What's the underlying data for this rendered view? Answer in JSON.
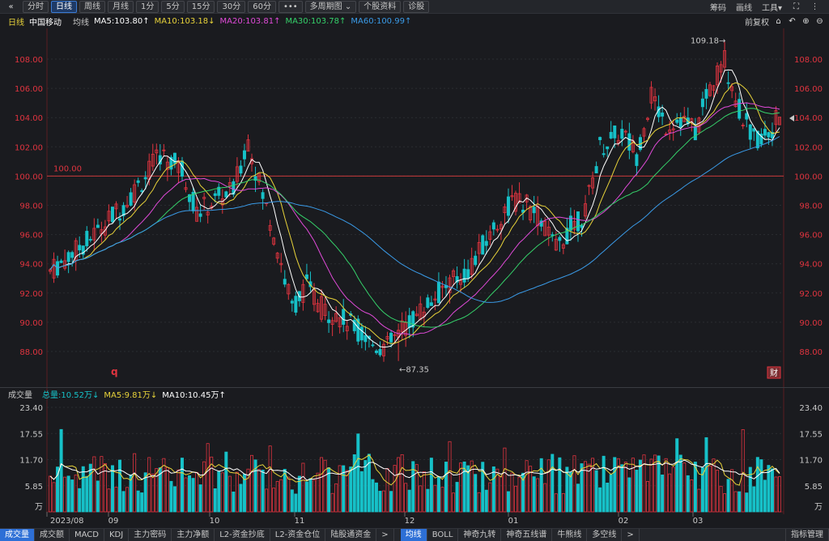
{
  "toolbar": {
    "back_icon": "«",
    "buttons": [
      "分时",
      "日线",
      "周线",
      "月线",
      "1分",
      "5分",
      "15分",
      "30分",
      "60分",
      "•••",
      "多周期图 ⌄",
      "个股资料",
      "诊股"
    ],
    "active_index": 1,
    "right_items": [
      "筹码",
      "画线",
      "工具▾"
    ],
    "right_icons": [
      "expand-icon",
      "more-icon"
    ]
  },
  "header": {
    "period": "日线",
    "name": "中国移动",
    "ma_label": "均线",
    "ma5": "MA5:103.80↑",
    "ma10": "MA10:103.18↓",
    "ma20": "MA20:103.81↑",
    "ma30": "MA30:103.78↑",
    "ma60": "MA60:100.99↑",
    "adjust": "前复权",
    "colors": {
      "ma5": "#ffffff",
      "ma10": "#e8d33a",
      "ma20": "#e04ad8",
      "ma30": "#35d16a",
      "ma60": "#3a9be8",
      "up": "#e0343f",
      "down": "#16c1c8"
    }
  },
  "price_axis": [
    "108.00",
    "106.00",
    "104.00",
    "102.00",
    "100.00",
    "98.00",
    "96.00",
    "94.00",
    "92.00",
    "90.00",
    "88.00"
  ],
  "annotations": {
    "high": "109.18→",
    "low": "←87.35",
    "ref_line": "100.00",
    "marker_q": "q",
    "marker_cai": "财"
  },
  "volume": {
    "title": "成交量",
    "total": "总量:10.52万↓",
    "ma5": "MA5:9.81万↓",
    "ma10": "MA10:10.45万↑",
    "axis": [
      "23.40",
      "17.55",
      "11.70",
      "5.85",
      "万"
    ]
  },
  "date_axis": [
    "2023/08",
    "09",
    "10",
    "11",
    "12",
    "01",
    "02",
    "03"
  ],
  "bottom_tabs": [
    "成交量",
    "成交额",
    "MACD",
    "KDJ",
    "主力密码",
    "主力净额",
    "L2-资金抄底",
    "L2-资金仓位",
    "陆股通资金",
    ">",
    "均线",
    "BOLL",
    "神奇九转",
    "神奇五线谱",
    "牛熊线",
    "多空线",
    ">",
    "指标管理"
  ],
  "bottom_active": [
    0,
    10
  ],
  "chart_data": {
    "type": "candlestick",
    "symbol": "中国移动",
    "period": "daily",
    "y_range": [
      87.35,
      109.18
    ],
    "moving_averages": [
      "MA5",
      "MA10",
      "MA20",
      "MA30",
      "MA60"
    ],
    "reference_line": 100.0,
    "high": 109.18,
    "low": 87.35,
    "volume_unit": "万",
    "volume_range": [
      0,
      23.4
    ]
  }
}
